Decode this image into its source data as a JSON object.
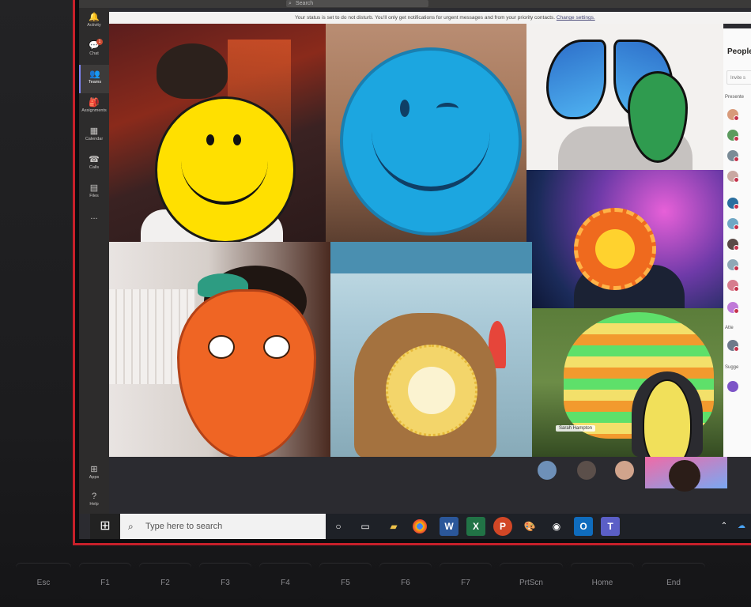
{
  "titlebar": {
    "search_label": "Search"
  },
  "banner": {
    "message": "Your status is set to do not disturb. You'll only get notifications for urgent messages and from your priority contacts.",
    "link": "Change settings."
  },
  "rail": {
    "items": [
      {
        "label": "Activity",
        "icon": "bell-icon"
      },
      {
        "label": "Chat",
        "icon": "chat-icon",
        "badge": "1"
      },
      {
        "label": "Teams",
        "icon": "teams-icon"
      },
      {
        "label": "Assignments",
        "icon": "assignments-icon"
      },
      {
        "label": "Calendar",
        "icon": "calendar-icon"
      },
      {
        "label": "Calls",
        "icon": "phone-icon"
      },
      {
        "label": "Files",
        "icon": "files-icon"
      },
      {
        "label": "...",
        "icon": "more-icon"
      }
    ],
    "bottom": [
      {
        "label": "Apps",
        "icon": "apps-icon"
      },
      {
        "label": "Help",
        "icon": "help-icon"
      }
    ]
  },
  "people": {
    "title": "People",
    "invite_placeholder": "Invite s",
    "sections": {
      "presenters": "Presente",
      "attendees": "Atte",
      "suggestions": "Sugge"
    }
  },
  "taskbar": {
    "search_placeholder": "Type here to search",
    "apps": [
      "task-view-icon",
      "file-explorer-icon",
      "chrome-icon",
      "word-icon",
      "excel-icon",
      "powerpoint-icon",
      "paint-icon",
      "people-icon",
      "outlook-icon",
      "teams-icon"
    ]
  },
  "video_label": "Sarah Hampton",
  "keyboard": {
    "keys": [
      "Esc",
      "F1",
      "F2",
      "F3",
      "F4",
      "F5",
      "F6",
      "F7",
      "PrtScn",
      "Home",
      "End"
    ]
  },
  "colors": {
    "bezel_accent": "#c8202a",
    "teams_purple": "#7f85f5"
  }
}
